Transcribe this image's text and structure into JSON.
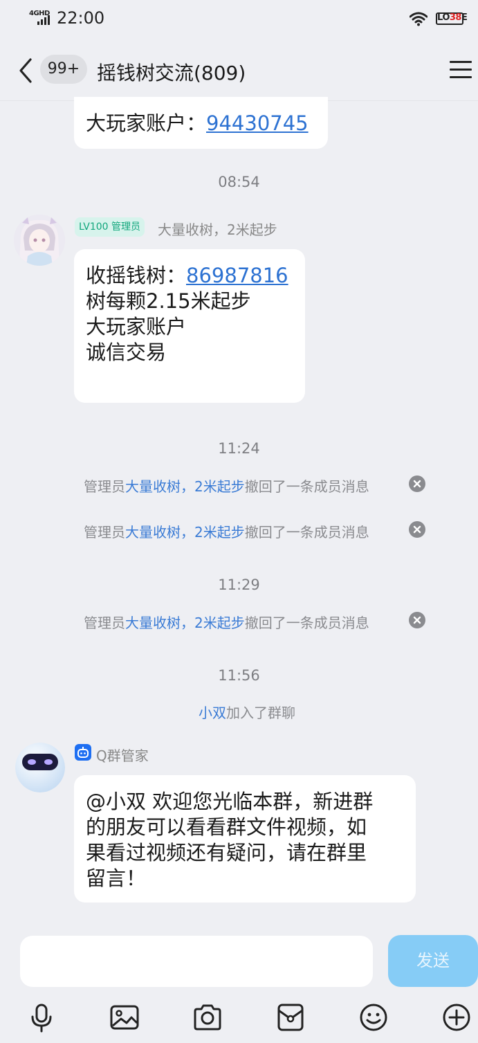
{
  "status_bar": {
    "network": "4GHD",
    "time": "22:00",
    "battery_label_prefix": "LO",
    "battery_label_mid": "38",
    "battery_label_suffix": "E"
  },
  "header": {
    "unread_badge": "99+",
    "title": "摇钱树交流(809)"
  },
  "messages": {
    "partial": {
      "prefix": "大玩家账户：",
      "link": "94430745"
    },
    "time_1": "08:54",
    "admin_msg": {
      "level_tag": "LV100 管理员",
      "sender": "大量收树，2米起步",
      "line1_prefix": "收摇钱树：",
      "line1_link": "86987816",
      "line2": "树每颗2.15米起步",
      "line3": "大玩家账户",
      "line4": "诚信交易"
    },
    "time_2": "11:24",
    "recall_1": {
      "prefix": "管理员",
      "name": "大量收树，2米起步",
      "suffix": "撤回了一条成员消息"
    },
    "recall_2": {
      "prefix": "管理员",
      "name": "大量收树，2米起步",
      "suffix": "撤回了一条成员消息"
    },
    "time_3": "11:29",
    "recall_3": {
      "prefix": "管理员",
      "name": "大量收树，2米起步",
      "suffix": "撤回了一条成员消息"
    },
    "time_4": "11:56",
    "join": {
      "name": "小双",
      "suffix": "加入了群聊"
    },
    "bot_msg": {
      "sender": "Q群管家",
      "line1": "@小双 欢迎您光临本群，新进群",
      "line2": "的朋友可以看看群文件视频，如",
      "line3": "果看过视频还有疑问，请在群里",
      "line4": "留言！"
    }
  },
  "input_bar": {
    "placeholder": "",
    "send_label": "发送"
  },
  "colors": {
    "background": "#eeeff3",
    "link": "#2d72d2",
    "send_button": "#86ccf6",
    "admin_tag": "#11a67c"
  },
  "toolbar_icons": [
    "microphone-icon",
    "image-icon",
    "camera-icon",
    "red-packet-icon",
    "emoji-icon",
    "plus-icon"
  ]
}
